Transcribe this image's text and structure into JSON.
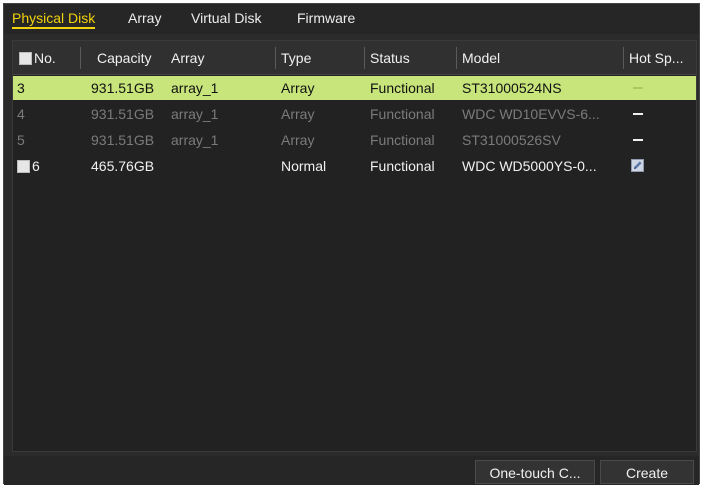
{
  "tabs": [
    {
      "label": "Physical Disk",
      "active": true
    },
    {
      "label": "Array",
      "active": false
    },
    {
      "label": "Virtual Disk",
      "active": false
    },
    {
      "label": "Firmware",
      "active": false
    }
  ],
  "table": {
    "headers": [
      "No.",
      "Capacity",
      "Array",
      "Type",
      "Status",
      "Model",
      "Hot Sp..."
    ],
    "rows": [
      {
        "no": "3",
        "capacity": "931.51GB",
        "array": "array_1",
        "type": "Array",
        "status": "Functional",
        "model": "ST31000524NS",
        "hot_spare": "dash-icon",
        "state": "selected"
      },
      {
        "no": "4",
        "capacity": "931.51GB",
        "array": "array_1",
        "type": "Array",
        "status": "Functional",
        "model": "WDC WD10EVVS-6...",
        "hot_spare": "dash-icon",
        "state": "dim"
      },
      {
        "no": "5",
        "capacity": "931.51GB",
        "array": "array_1",
        "type": "Array",
        "status": "Functional",
        "model": "ST31000526SV",
        "hot_spare": "dash-icon",
        "state": "dim"
      },
      {
        "no": "6",
        "capacity": "465.76GB",
        "array": "",
        "type": "Normal",
        "status": "Functional",
        "model": "WDC WD5000YS-0...",
        "hot_spare": "edit-icon",
        "state": "normal"
      }
    ]
  },
  "footer": {
    "one_touch_label": "One-touch C...",
    "create_label": "Create"
  },
  "colors": {
    "accent": "#f2d20c",
    "selected_row": "#c7e57a"
  }
}
